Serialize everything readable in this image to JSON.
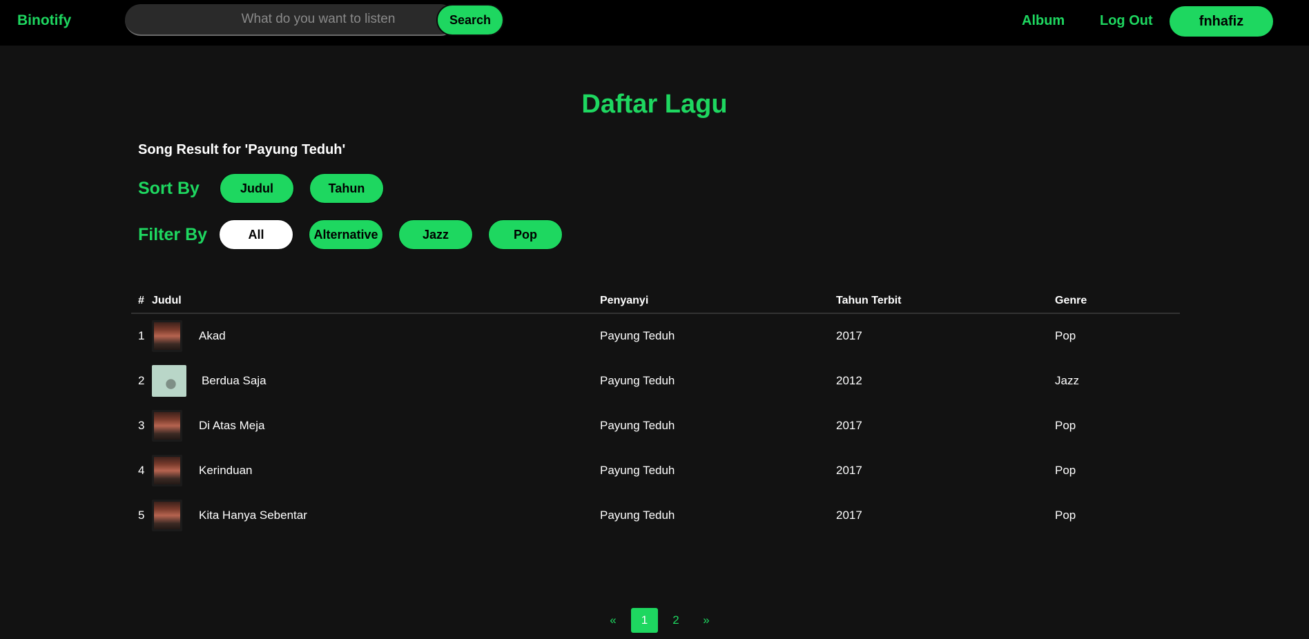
{
  "navbar": {
    "brand": "Binotify",
    "search_placeholder": "What do you want to listen",
    "search_label": "Search",
    "album_label": "Album",
    "logout_label": "Log Out",
    "username": "fnhafiz"
  },
  "main": {
    "title": "Daftar Lagu",
    "result_caption": "Song Result for 'Payung Teduh'",
    "sort_label": "Sort By",
    "sort_options": [
      "Judul",
      "Tahun"
    ],
    "filter_label": "Filter By",
    "filter_options": [
      "All",
      "Alternative",
      "Jazz",
      "Pop"
    ],
    "filter_selected": "All"
  },
  "table": {
    "headers": [
      "#",
      "Judul",
      "Penyanyi",
      "Tahun Terbit",
      "Genre"
    ],
    "rows": [
      {
        "num": "1",
        "title": "Akad",
        "artist": "Payung Teduh",
        "year": "2017",
        "genre": "Pop",
        "cover": "dark-album-cover"
      },
      {
        "num": "2",
        "title": "Berdua Saja",
        "artist": "Payung Teduh",
        "year": "2012",
        "genre": "Jazz",
        "cover": "light-album-cover"
      },
      {
        "num": "3",
        "title": "Di Atas Meja",
        "artist": "Payung Teduh",
        "year": "2017",
        "genre": "Pop",
        "cover": "dark-album-cover"
      },
      {
        "num": "4",
        "title": "Kerinduan",
        "artist": "Payung Teduh",
        "year": "2017",
        "genre": "Pop",
        "cover": "dark-album-cover"
      },
      {
        "num": "5",
        "title": "Kita Hanya Sebentar",
        "artist": "Payung Teduh",
        "year": "2017",
        "genre": "Pop",
        "cover": "dark-album-cover"
      }
    ]
  },
  "pagination": {
    "prev": "«",
    "pages": [
      "1",
      "2"
    ],
    "current": "1",
    "next": "»"
  },
  "colors": {
    "accent": "#1ed760",
    "background": "#121212",
    "navbar": "#000000"
  }
}
